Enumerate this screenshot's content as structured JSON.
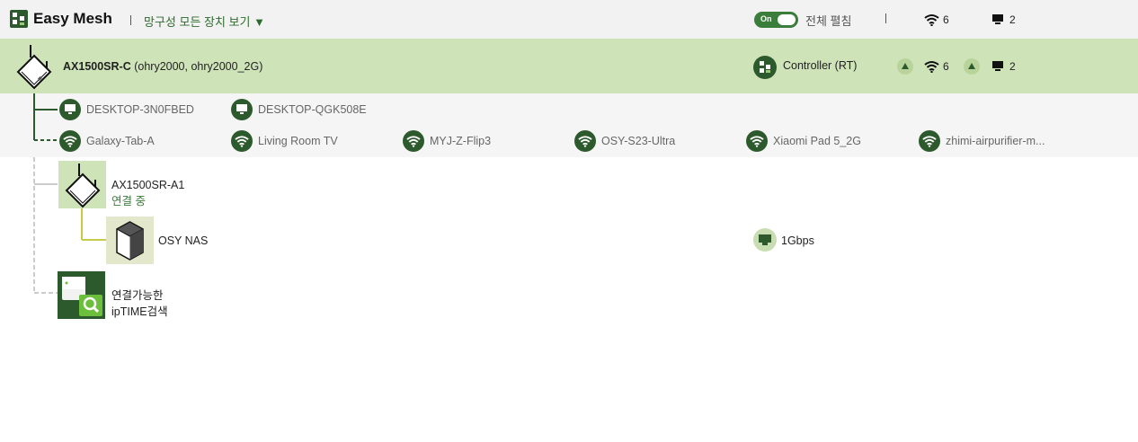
{
  "header": {
    "app_title": "Easy Mesh",
    "view_all_label": "망구성 모든 장치 보기 ▼",
    "toggle_label": "On",
    "edit_all_label": "전체 펼침",
    "wifi_count": "6",
    "wired_count": "2"
  },
  "controller": {
    "name": "AX1500SR-C",
    "ssids": "(ohry2000, ohry2000_2G)",
    "role": "Controller (RT)",
    "wifi_count": "6",
    "wired_count": "2"
  },
  "wired_clients": [
    {
      "name": "DESKTOP-3N0FBED",
      "icon": "monitor-icon"
    },
    {
      "name": "DESKTOP-QGK508E",
      "icon": "monitor-icon"
    }
  ],
  "wifi_clients": [
    {
      "name": "Galaxy-Tab-A",
      "icon": "wifi-icon"
    },
    {
      "name": "Living Room TV",
      "icon": "wifi-icon"
    },
    {
      "name": "MYJ-Z-Flip3",
      "icon": "wifi-icon"
    },
    {
      "name": "OSY-S23-Ultra",
      "icon": "wifi-icon"
    },
    {
      "name": "Xiaomi Pad 5_2G",
      "icon": "wifi-icon"
    },
    {
      "name": "zhimi-airpurifier-m...",
      "icon": "wifi-icon"
    }
  ],
  "tree": {
    "agent": {
      "name": "AX1500SR-A1",
      "status": "연결 중"
    },
    "nas": {
      "name": "OSY NAS",
      "speed": "1Gbps"
    },
    "search": {
      "line1": "연결가능한",
      "line2": "ipTIME검색"
    }
  },
  "colors": {
    "accent": "#2d5a2d",
    "controller_bg": "#cfe3b8",
    "header_bg": "#f2f2f2",
    "status_green": "#3b7d3b"
  }
}
